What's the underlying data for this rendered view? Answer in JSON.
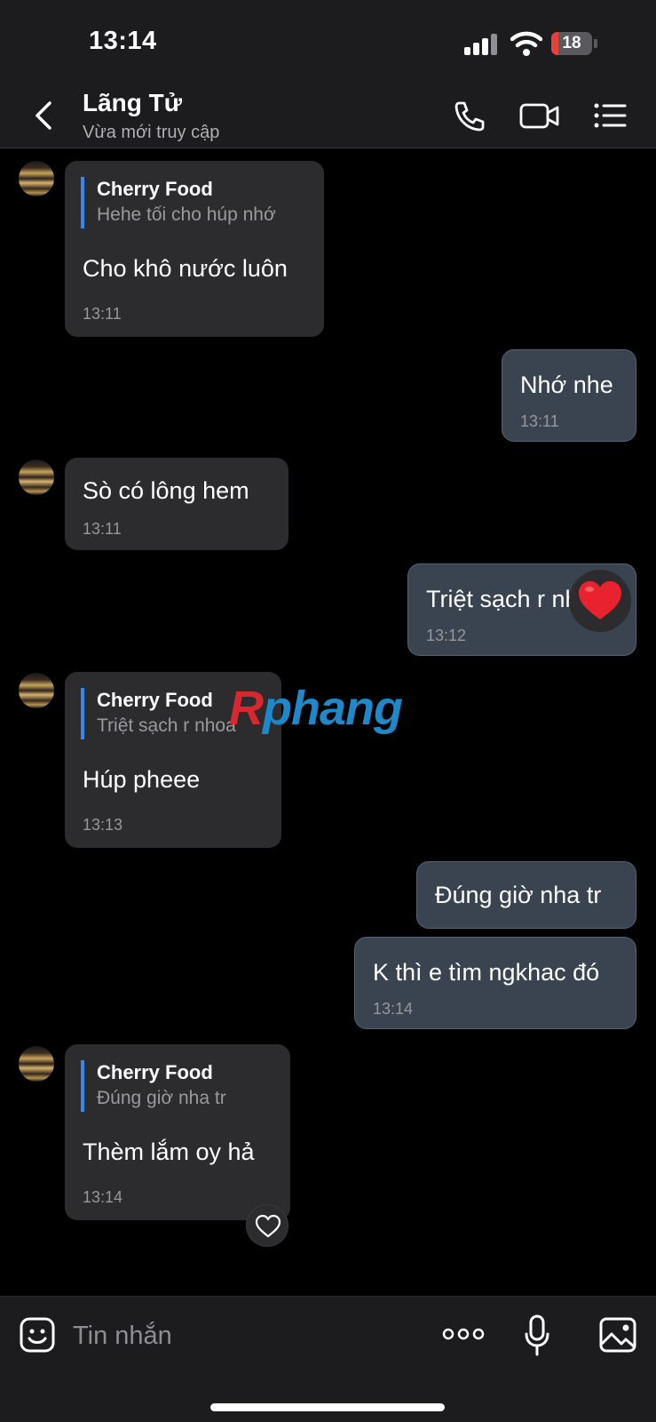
{
  "status_bar": {
    "time": "13:14",
    "battery": "18",
    "battery_level": 0.18
  },
  "header": {
    "contact_name": "Lãng Tử",
    "status": "Vừa mới truy cập"
  },
  "messages": [
    {
      "quote_name": "Cherry Food",
      "quote_text": "Hehe tối cho húp nhớ",
      "text": "Cho khô nước luôn",
      "time": "13:11"
    },
    {
      "text": "Nhớ nhe",
      "time": "13:11"
    },
    {
      "text": "Sò có lông hem",
      "time": "13:11"
    },
    {
      "text": "Triệt sạch r nhoa",
      "time": "13:12"
    },
    {
      "quote_name": "Cherry Food",
      "quote_text": "Triệt sạch r nhoa",
      "text": "Húp pheee",
      "time": "13:13"
    },
    {
      "text": "Đúng giờ nha tr"
    },
    {
      "text": "K thì e tìm ngkhac đó",
      "time": "13:14"
    },
    {
      "quote_name": "Cherry Food",
      "quote_text": "Đúng giờ nha tr",
      "text": "Thèm lắm oy hả",
      "time": "13:14"
    }
  ],
  "watermark": {
    "part1": "R",
    "part2": "phang"
  },
  "composer": {
    "placeholder": "Tin nhắn"
  },
  "colors": {
    "quote_bar": "#2f8cf5",
    "reaction_heart": "#e8232f",
    "battery_low": "#e8413a"
  },
  "icons": [
    "back-icon",
    "phone-icon",
    "video-call-icon",
    "menu-list-icon",
    "sticker-icon",
    "more-icon",
    "microphone-icon",
    "image-icon",
    "heart-reaction-icon",
    "like-icon"
  ]
}
